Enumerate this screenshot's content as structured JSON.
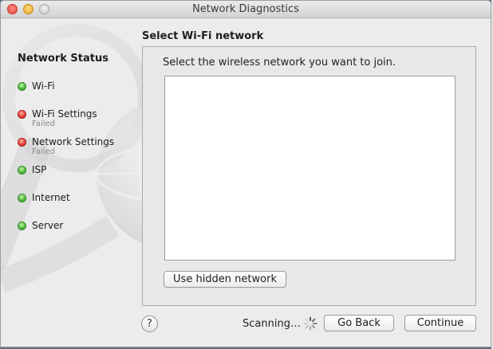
{
  "window": {
    "title": "Network Diagnostics"
  },
  "sidebar": {
    "heading": "Network Status",
    "steps": [
      {
        "label": "Wi-Fi",
        "status": "green",
        "sub": ""
      },
      {
        "label": "Wi-Fi Settings",
        "status": "red",
        "sub": "Failed"
      },
      {
        "label": "Network Settings",
        "status": "red",
        "sub": "Failed"
      },
      {
        "label": "ISP",
        "status": "green",
        "sub": ""
      },
      {
        "label": "Internet",
        "status": "green",
        "sub": ""
      },
      {
        "label": "Server",
        "status": "green",
        "sub": ""
      }
    ]
  },
  "main": {
    "title": "Select Wi-Fi network",
    "instruction": "Select the wireless network you want to join.",
    "hidden_network_label": "Use hidden network"
  },
  "footer": {
    "help_label": "?",
    "scanning_text": "Scanning…",
    "go_back_label": "Go Back",
    "continue_label": "Continue"
  },
  "colors": {
    "status_green": "#4ab43a",
    "status_red": "#e23a2e"
  },
  "icons": [
    "help-icon",
    "spinner-icon"
  ]
}
